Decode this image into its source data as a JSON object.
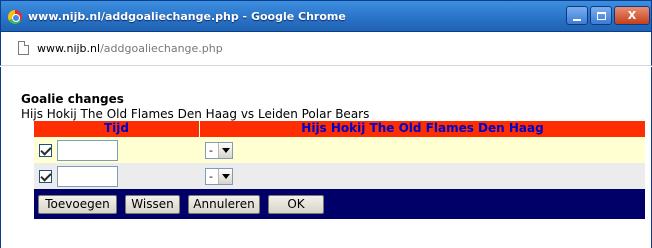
{
  "window": {
    "title": "www.nijb.nl/addgoaliechange.php - Google Chrome",
    "minimize_label": "",
    "maximize_label": "",
    "close_label": "X"
  },
  "address": {
    "host": "www.nijb.nl",
    "path": "/addgoaliechange.php",
    "icon": "page-icon"
  },
  "page": {
    "heading": "Goalie changes",
    "match": "Hijs Hokij The Old Flames Den Haag vs Leiden Polar Bears",
    "columns": [
      "Tijd",
      "Hijs Hokij The Old Flames Den Haag"
    ],
    "rows": [
      {
        "checked": true,
        "time": "",
        "goalie": "-"
      },
      {
        "checked": true,
        "time": "",
        "goalie": "-"
      }
    ],
    "buttons": {
      "add": "Toevoegen",
      "clear": "Wissen",
      "cancel": "Annuleren",
      "ok": "OK"
    }
  },
  "colors": {
    "header_bg": "#ff2e00",
    "header_text": "#0000c8",
    "row1_bg": "#ffffd2",
    "row2_bg": "#ececec",
    "button_bar_bg": "#000068"
  }
}
